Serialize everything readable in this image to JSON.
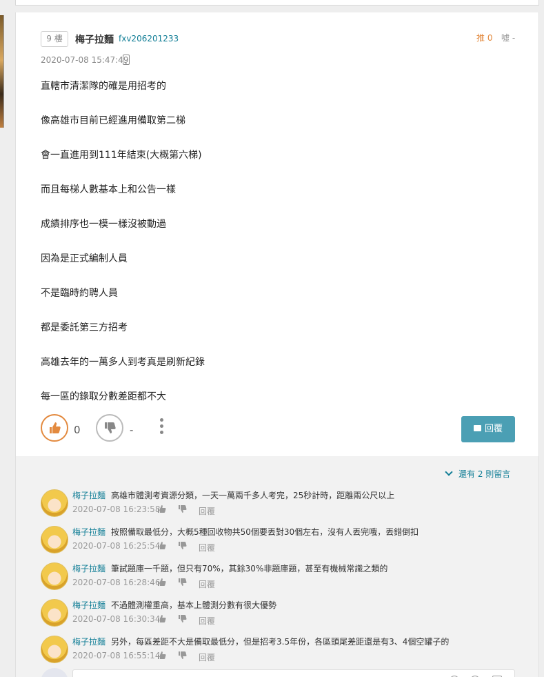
{
  "post": {
    "floor": "9 樓",
    "author_name": "梅子拉麵",
    "author_id": "fxv206201233",
    "push_label": "推 0",
    "boo_label": "噓 -",
    "timestamp": "2020-07-08 15:47:49",
    "lines": [
      "直轄市清潔隊的確是用招考的",
      "像高雄市目前已經進用備取第二梯",
      "會一直進用到111年結束(大概第六梯)",
      "而且每梯人數基本上和公告一樣",
      "成績排序也一模一樣沒被動過",
      "因為是正式編制人員",
      "不是臨時約聘人員",
      "都是委託第三方招考",
      "高雄去年的一萬多人到考真是刷新紀錄",
      "每一區的錄取分數差距都不大"
    ],
    "like_count": "0",
    "dislike_count": "-",
    "reply_label": "回覆"
  },
  "comments_section": {
    "more_label": "還有 2 則留言",
    "reply_label": "回覆",
    "items": [
      {
        "name": "梅子拉麵",
        "text": "高雄市體測考資源分類，一天一萬兩千多人考完，25秒計時，距離兩公尺以上",
        "time": "2020-07-08 16:23:58"
      },
      {
        "name": "梅子拉麵",
        "text": "按照備取最低分，大概5種回收物共50個要丟對30個左右，沒有人丟完哦，丟錯倒扣",
        "time": "2020-07-08 16:25:54"
      },
      {
        "name": "梅子拉麵",
        "text": "筆試題庫一千題，但只有70%，其餘30%非題庫題，甚至有機械常識之類的",
        "time": "2020-07-08 16:28:46"
      },
      {
        "name": "梅子拉麵",
        "text": "不過體測權重高，基本上體測分數有很大優勢",
        "time": "2020-07-08 16:30:34"
      },
      {
        "name": "梅子拉麵",
        "text": "另外，每區差距不大是備取最低分，但是招考3.5年份，各區頭尾差距還是有3、4個空罐子的",
        "time": "2020-07-08 16:55:14"
      }
    ]
  },
  "colors": {
    "accent_teal": "#117e96",
    "push_orange": "#e38a3f",
    "reply_button": "#4b9fb4"
  }
}
